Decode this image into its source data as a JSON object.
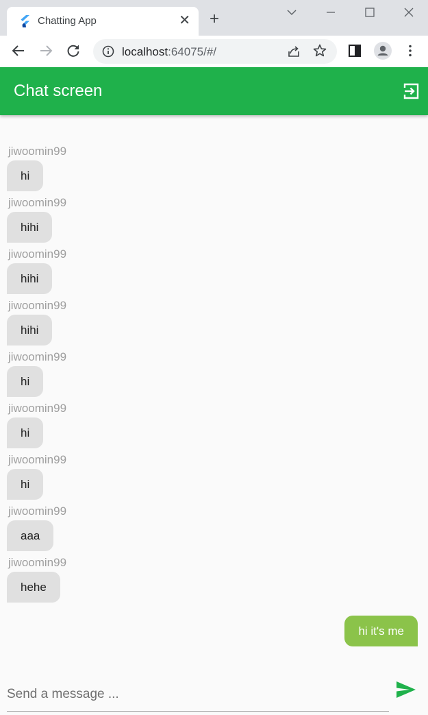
{
  "browser": {
    "tab_title": "Chatting App",
    "tab_close": "✕",
    "new_tab": "+",
    "url_host": "localhost",
    "url_path": ":64075/#/"
  },
  "app": {
    "title": "Chat screen",
    "accent_color": "#1fb14b"
  },
  "messages": [
    {
      "user": "jiwoomin99",
      "text": "hi"
    },
    {
      "user": "jiwoomin99",
      "text": "hihi"
    },
    {
      "user": "jiwoomin99",
      "text": "hihi"
    },
    {
      "user": "jiwoomin99",
      "text": "hihi"
    },
    {
      "user": "jiwoomin99",
      "text": "hi"
    },
    {
      "user": "jiwoomin99",
      "text": "hi"
    },
    {
      "user": "jiwoomin99",
      "text": "hi"
    },
    {
      "user": "jiwoomin99",
      "text": "aaa"
    },
    {
      "user": "jiwoomin99",
      "text": "hehe"
    }
  ],
  "my_message": {
    "text": "hi it's me"
  },
  "composer": {
    "placeholder": "Send a message ..."
  }
}
